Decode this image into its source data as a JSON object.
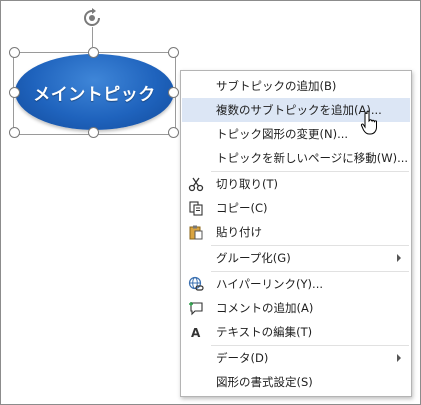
{
  "topic": {
    "label": "メイントピック"
  },
  "menu": {
    "items": [
      {
        "label": "サブトピックの追加(B)",
        "icon": ""
      },
      {
        "label": "複数のサブトピックを追加(A)...",
        "icon": ""
      },
      {
        "label": "トピック図形の変更(N)...",
        "icon": ""
      },
      {
        "label": "トピックを新しいページに移動(W)...",
        "icon": ""
      },
      {
        "label": "切り取り(T)",
        "icon": "scissors-icon"
      },
      {
        "label": "コピー(C)",
        "icon": "copy-icon"
      },
      {
        "label": "貼り付け",
        "icon": "paste-icon"
      },
      {
        "label": "グループ化(G)",
        "icon": ""
      },
      {
        "label": "ハイパーリンク(Y)...",
        "icon": "hyperlink-icon"
      },
      {
        "label": "コメントの追加(A)",
        "icon": "comment-icon"
      },
      {
        "label": "テキストの編集(T)",
        "icon": "text-icon"
      },
      {
        "label": "データ(D)",
        "icon": ""
      },
      {
        "label": "図形の書式設定(S)",
        "icon": ""
      }
    ]
  },
  "colors": {
    "hover": "#dce6f5",
    "topic_fill": "#1f63bd"
  }
}
